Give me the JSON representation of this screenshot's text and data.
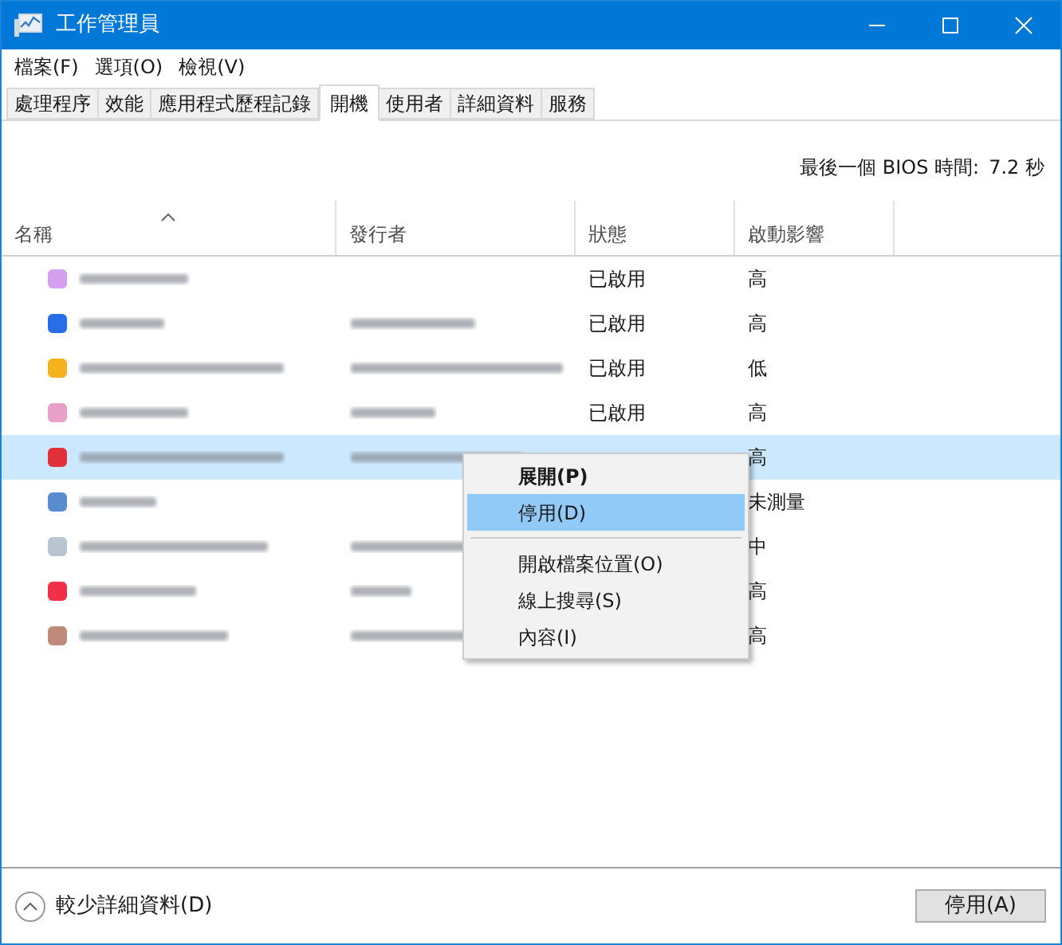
{
  "window": {
    "title": "工作管理員"
  },
  "menu": [
    "檔案(F)",
    "選項(O)",
    "檢視(V)"
  ],
  "tabs": [
    {
      "label": "處理程序",
      "selected": false
    },
    {
      "label": "效能",
      "selected": false
    },
    {
      "label": "應用程式歷程記錄",
      "selected": false
    },
    {
      "label": "開機",
      "selected": true
    },
    {
      "label": "使用者",
      "selected": false
    },
    {
      "label": "詳細資料",
      "selected": false
    },
    {
      "label": "服務",
      "selected": false
    }
  ],
  "bios_time": {
    "label": "最後一個 BIOS 時間:",
    "value": "7.2 秒"
  },
  "table": {
    "columns": [
      "名稱",
      "發行者",
      "狀態",
      "啟動影響"
    ],
    "rows": [
      {
        "color": "#d7a0ee",
        "status": "已啟用",
        "impact": "高",
        "selected": false
      },
      {
        "color": "#2a6de8",
        "status": "已啟用",
        "impact": "高",
        "selected": false
      },
      {
        "color": "#f5b21f",
        "status": "已啟用",
        "impact": "低",
        "selected": false
      },
      {
        "color": "#e8a0c8",
        "status": "已啟用",
        "impact": "高",
        "selected": false
      },
      {
        "color": "#e0303a",
        "impact": "高",
        "selected": true
      },
      {
        "color": "#5a8ad0",
        "impact": "未測量",
        "selected": false
      },
      {
        "color": "#b8c4d0",
        "impact": "中",
        "selected": false
      },
      {
        "color": "#f03048",
        "impact": "高",
        "selected": false
      },
      {
        "color": "#c08a7a",
        "impact": "高",
        "selected": false
      }
    ]
  },
  "context_menu": [
    {
      "label": "展開(P)",
      "bold": true,
      "selected": false,
      "divider_after": false
    },
    {
      "label": "停用(D)",
      "bold": false,
      "selected": true,
      "divider_after": true
    },
    {
      "label": "開啟檔案位置(O)",
      "bold": false,
      "selected": false,
      "divider_after": false
    },
    {
      "label": "線上搜尋(S)",
      "bold": false,
      "selected": false,
      "divider_after": false
    },
    {
      "label": "內容(I)",
      "bold": false,
      "selected": false,
      "divider_after": false
    }
  ],
  "footer": {
    "toggle_label": "較少詳細資料(D)",
    "button": "停用(A)"
  }
}
